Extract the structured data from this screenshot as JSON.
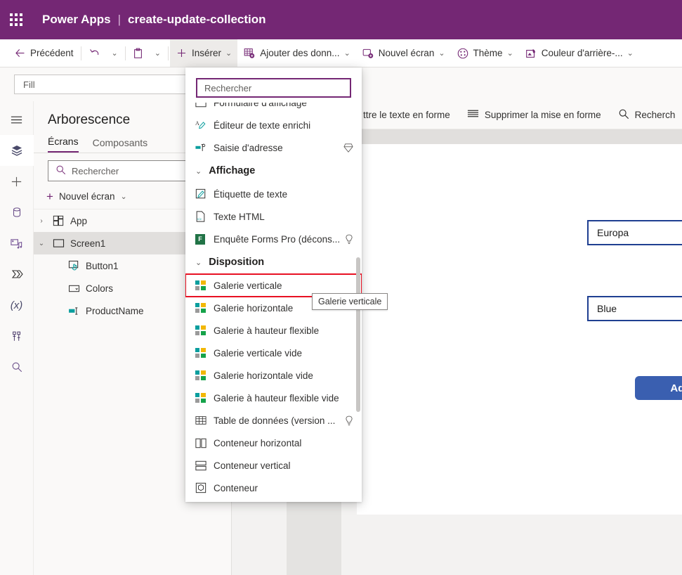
{
  "topbar": {
    "waffle_icon": "app-launcher-icon",
    "brand": "Power Apps",
    "separator": "|",
    "app_name": "create-update-collection"
  },
  "command_bar": {
    "back": {
      "label": "Précédent",
      "icon": "arrow-left-icon"
    },
    "undo": {
      "icon": "undo-icon"
    },
    "undo_chevron": "⌄",
    "paste": {
      "icon": "clipboard-icon"
    },
    "paste_chevron": "⌄",
    "insert": {
      "label": "Insérer",
      "icon": "plus-icon",
      "chevron": "⌄"
    },
    "add_data": {
      "label": "Ajouter des donn...",
      "icon": "table-add-icon",
      "chevron": "⌄"
    },
    "new_screen": {
      "label": "Nouvel écran",
      "icon": "screen-add-icon",
      "chevron": "⌄"
    },
    "theme": {
      "label": "Thème",
      "icon": "palette-icon",
      "chevron": "⌄"
    },
    "background_color": {
      "label": "Couleur d'arrière-...",
      "icon": "background-color-icon",
      "chevron": "⌄"
    }
  },
  "formula": {
    "property": "Fill",
    "value": ""
  },
  "toolbar2": {
    "format_text": "ttre le texte en forme",
    "clear_format": "Supprimer la mise en forme",
    "search": "Recherch",
    "clear_format_icon": "lines-icon",
    "search_icon": "search-icon"
  },
  "rail": {
    "items": [
      {
        "name": "hamburger-icon",
        "selected": false
      },
      {
        "name": "tree-view-icon",
        "selected": true
      },
      {
        "name": "insert-icon",
        "selected": false
      },
      {
        "name": "data-icon",
        "selected": false
      },
      {
        "name": "media-icon",
        "selected": false
      },
      {
        "name": "power-automate-icon",
        "selected": false
      },
      {
        "name": "variables-icon",
        "selected": false
      },
      {
        "name": "app-checker-icon",
        "selected": false
      },
      {
        "name": "search-icon",
        "selected": false
      }
    ]
  },
  "tree": {
    "title": "Arborescence",
    "tabs": [
      {
        "label": "Écrans",
        "selected": true
      },
      {
        "label": "Composants",
        "selected": false
      }
    ],
    "search_placeholder": "Rechercher",
    "new_screen_label": "Nouvel écran",
    "new_screen_chevron": "⌄",
    "nodes": [
      {
        "label": "App",
        "icon": "app-icon",
        "twisty": "›",
        "selected": false,
        "indent": false
      },
      {
        "label": "Screen1",
        "icon": "screen-icon",
        "twisty": "⌄",
        "selected": true,
        "indent": false
      },
      {
        "label": "Button1",
        "icon": "button-icon",
        "twisty": "",
        "selected": false,
        "indent": true
      },
      {
        "label": "Colors",
        "icon": "dropdown-icon",
        "twisty": "",
        "selected": false,
        "indent": true
      },
      {
        "label": "ProductName",
        "icon": "textinput-icon",
        "twisty": "",
        "selected": false,
        "indent": true
      }
    ]
  },
  "insert_panel": {
    "search_placeholder": "Rechercher",
    "tooltip": "Galerie verticale",
    "items": [
      {
        "type": "item",
        "label": "Formulaire d'affichage",
        "icon": "display-form-icon",
        "clipped": true
      },
      {
        "type": "item",
        "label": "Éditeur de texte enrichi",
        "icon": "rich-text-editor-icon"
      },
      {
        "type": "item",
        "label": "Saisie d'adresse",
        "icon": "address-input-icon",
        "trail": "premium-diamond-icon"
      },
      {
        "type": "group",
        "label": "Affichage",
        "chevron": "⌄"
      },
      {
        "type": "item",
        "label": "Étiquette de texte",
        "icon": "text-label-icon"
      },
      {
        "type": "item",
        "label": "Texte HTML",
        "icon": "html-text-icon"
      },
      {
        "type": "item",
        "label": "Enquête Forms Pro (décons...",
        "icon": "forms-pro-icon",
        "trail": "preview-bulb-icon"
      },
      {
        "type": "group",
        "label": "Disposition",
        "chevron": "⌄"
      },
      {
        "type": "item",
        "label": "Galerie verticale",
        "icon": "gallery-icon",
        "highlight": true
      },
      {
        "type": "item",
        "label": "Galerie horizontale",
        "icon": "gallery-icon"
      },
      {
        "type": "item",
        "label": "Galerie à hauteur flexible",
        "icon": "gallery-icon"
      },
      {
        "type": "item",
        "label": "Galerie verticale vide",
        "icon": "gallery-icon"
      },
      {
        "type": "item",
        "label": "Galerie horizontale vide",
        "icon": "gallery-icon"
      },
      {
        "type": "item",
        "label": "Galerie à hauteur flexible vide",
        "icon": "gallery-icon"
      },
      {
        "type": "item",
        "label": "Table de données (version ...",
        "icon": "data-table-icon",
        "trail": "preview-bulb-icon"
      },
      {
        "type": "item",
        "label": "Conteneur horizontal",
        "icon": "horizontal-container-icon"
      },
      {
        "type": "item",
        "label": "Conteneur vertical",
        "icon": "vertical-container-icon"
      },
      {
        "type": "item",
        "label": "Conteneur",
        "icon": "container-icon"
      }
    ]
  },
  "canvas": {
    "product_name_value": "Europa",
    "colors_value": "Blue",
    "colors_chevron": "⌄",
    "add_button_label": "Add"
  },
  "colors": {
    "brand_purple": "#742774",
    "accent_purple": "#742774",
    "control_border_blue": "#1f3f91",
    "dropdown_button_blue": "#2a57aa",
    "add_button_blue": "#3a5fb0",
    "highlight_red": "#e81123",
    "canvas_gray": "#e4e3e1",
    "panel_gray": "#faf9f8"
  }
}
